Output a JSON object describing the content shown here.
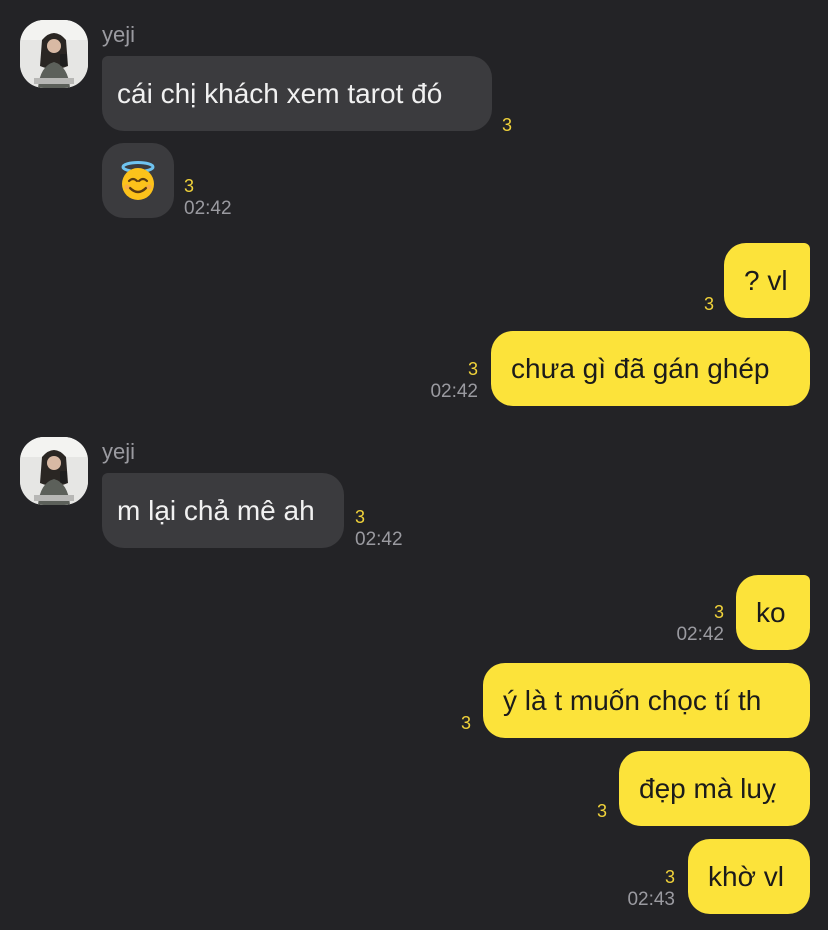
{
  "messages": [
    {
      "sender": "yeji",
      "text": "cái chị khách xem tarot đó",
      "unread": "3",
      "time": ""
    },
    {
      "sender": "yeji",
      "emoji": "smiling-face-with-halo",
      "unread": "3",
      "time": "02:42"
    },
    {
      "sender": "me",
      "text": "? vl",
      "unread": "3",
      "time": ""
    },
    {
      "sender": "me",
      "text": "chưa gì đã gán ghép",
      "unread": "3",
      "time": "02:42"
    },
    {
      "sender": "yeji",
      "text": "m lại chả mê ah",
      "unread": "3",
      "time": "02:42"
    },
    {
      "sender": "me",
      "text": "ko",
      "unread": "3",
      "time": "02:42"
    },
    {
      "sender": "me",
      "text": "ý là t muốn chọc tí th",
      "unread": "3",
      "time": ""
    },
    {
      "sender": "me",
      "text": "đẹp mà luỵ",
      "unread": "3",
      "time": ""
    },
    {
      "sender": "me",
      "text": "khờ vl",
      "unread": "3",
      "time": "02:43"
    }
  ],
  "colors": {
    "background": "#232326",
    "incoming_bubble": "#3b3b3e",
    "outgoing_bubble": "#fce33a",
    "unread_count": "#f0d23a",
    "timestamp": "#9a9aa0"
  }
}
